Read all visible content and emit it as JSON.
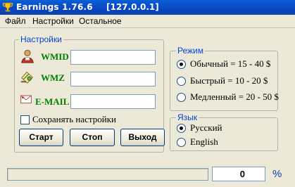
{
  "window": {
    "title": "Earnings 1.76.6",
    "address": "[127.0.0.1]",
    "icon": "trophy-icon"
  },
  "menu": [
    "Файл",
    "Настройки",
    "Остальное"
  ],
  "settings": {
    "legend": "Настройки",
    "fields": [
      {
        "label": "WMID",
        "value": "",
        "icon": "person-icon"
      },
      {
        "label": "WMZ",
        "value": "",
        "icon": "wallet-icon"
      },
      {
        "label": "E-MAIL",
        "value": "",
        "icon": "envelope-icon"
      }
    ],
    "save_checkbox": {
      "label": "Сохранять настройки",
      "checked": false
    },
    "buttons": {
      "start": "Старт",
      "stop": "Стоп",
      "exit": "Выход"
    }
  },
  "mode": {
    "legend": "Режим",
    "options": [
      {
        "label": "Обычный = 15 - 40 $",
        "checked": true
      },
      {
        "label": "Быстрый = 10 - 20 $",
        "checked": false
      },
      {
        "label": "Медленный = 20 - 50 $",
        "checked": false
      }
    ]
  },
  "language": {
    "legend": "Язык",
    "options": [
      {
        "label": "Русский",
        "checked": true
      },
      {
        "label": "English",
        "checked": false
      }
    ]
  },
  "status": {
    "progress": 0,
    "counter": "0",
    "percent_sign": "%"
  },
  "colors": {
    "title_bar": "#0a46c0",
    "legend_text": "#0046d5",
    "field_label": "#008000"
  }
}
